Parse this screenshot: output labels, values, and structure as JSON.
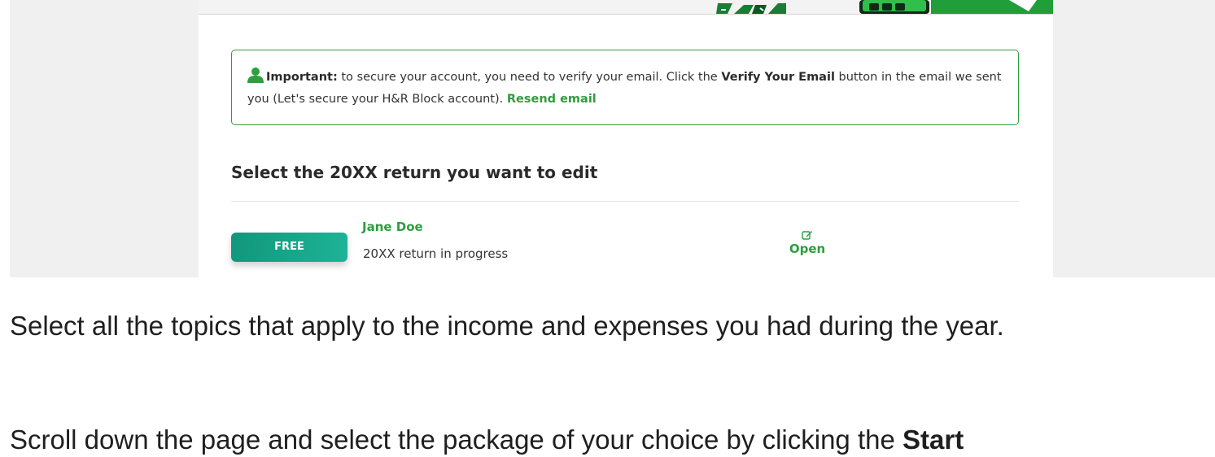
{
  "alert": {
    "important_label": "Important:",
    "text_1": " to secure your account, you need to verify your email. Click the ",
    "verify_label": "Verify Your Email",
    "text_2": " button in the email we sent you (Let's secure your H&R Block account). ",
    "resend_label": "Resend email",
    "person_icon": "person-icon"
  },
  "returns": {
    "title": "Select the 20XX return you want to edit",
    "items": [
      {
        "badge": "FREE",
        "name": "Jane Doe",
        "status": "20XX return in progress",
        "action_label": "Open",
        "action_icon": "edit-icon"
      }
    ]
  },
  "instructions": {
    "paragraph_1": "Select all the topics that apply to the income and expenses you had during the year.",
    "paragraph_2_prefix": "Scroll down the page and select the package of your choice by clicking the ",
    "paragraph_2_bold": "Start"
  },
  "colors": {
    "brand_green": "#2e9e3e",
    "badge_teal": "#14a085"
  }
}
